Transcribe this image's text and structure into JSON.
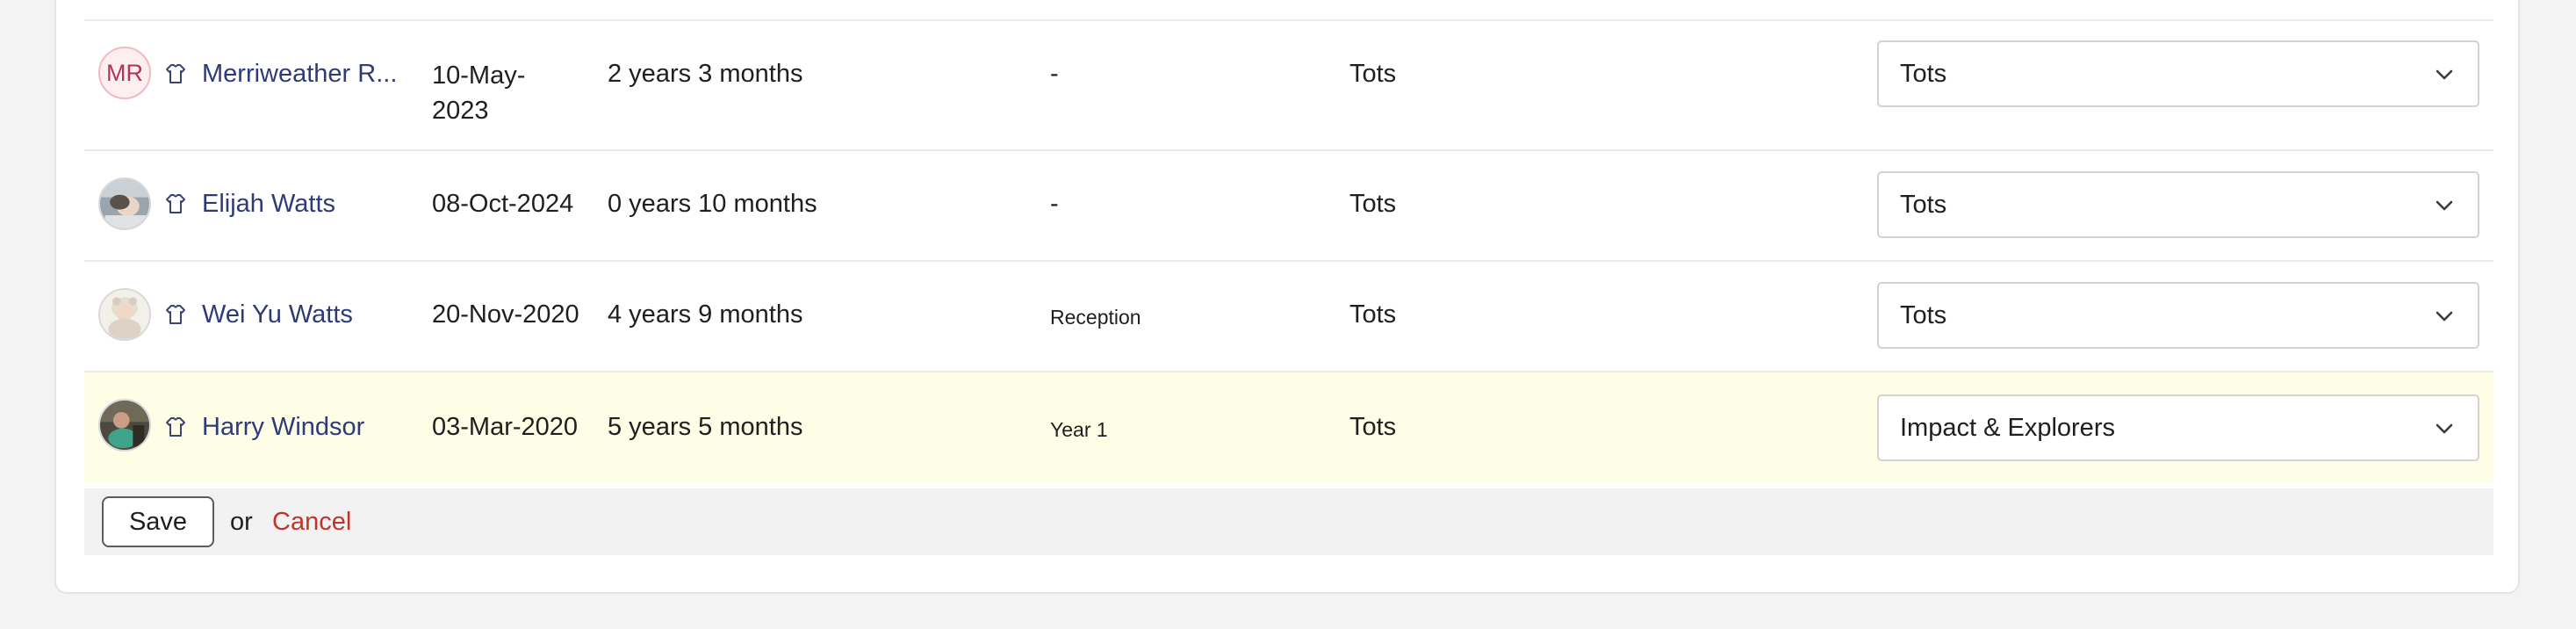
{
  "rows": [
    {
      "avatar_initials": "MR",
      "avatar_type": "initials",
      "role_icon": "shirt-icon",
      "name": "Merriweather R...",
      "dob_line1": "10-May-",
      "dob_line2": "2023",
      "age": "2 years 3 months",
      "school_year": "-",
      "current_group": "Tots",
      "selected_group": "Tots"
    },
    {
      "avatar_type": "photo",
      "role_icon": "shirt-icon",
      "name": "Elijah Watts",
      "dob": "08-Oct-2024",
      "age": "0 years 10 months",
      "school_year": "-",
      "current_group": "Tots",
      "selected_group": "Tots"
    },
    {
      "avatar_type": "photo",
      "role_icon": "shirt-icon",
      "name": "Wei Yu Watts",
      "dob": "20-Nov-2020",
      "age": "4 years 9 months",
      "school_year": "Reception",
      "current_group": "Tots",
      "selected_group": "Tots"
    },
    {
      "avatar_type": "photo",
      "role_icon": "shirt-icon",
      "name": "Harry Windsor",
      "dob": "03-Mar-2020",
      "age": "5 years 5 months",
      "school_year": "Year 1",
      "current_group": "Tots",
      "selected_group": "Impact & Explorers",
      "highlighted": true
    }
  ],
  "footer": {
    "save_label": "Save",
    "or_text": "or",
    "cancel_label": "Cancel"
  },
  "colors": {
    "link": "#2e3b78",
    "cancel": "#c0342b",
    "highlight_row": "#fefee6",
    "initials_bg": "#fdeef1",
    "initials_text": "#b03556"
  }
}
